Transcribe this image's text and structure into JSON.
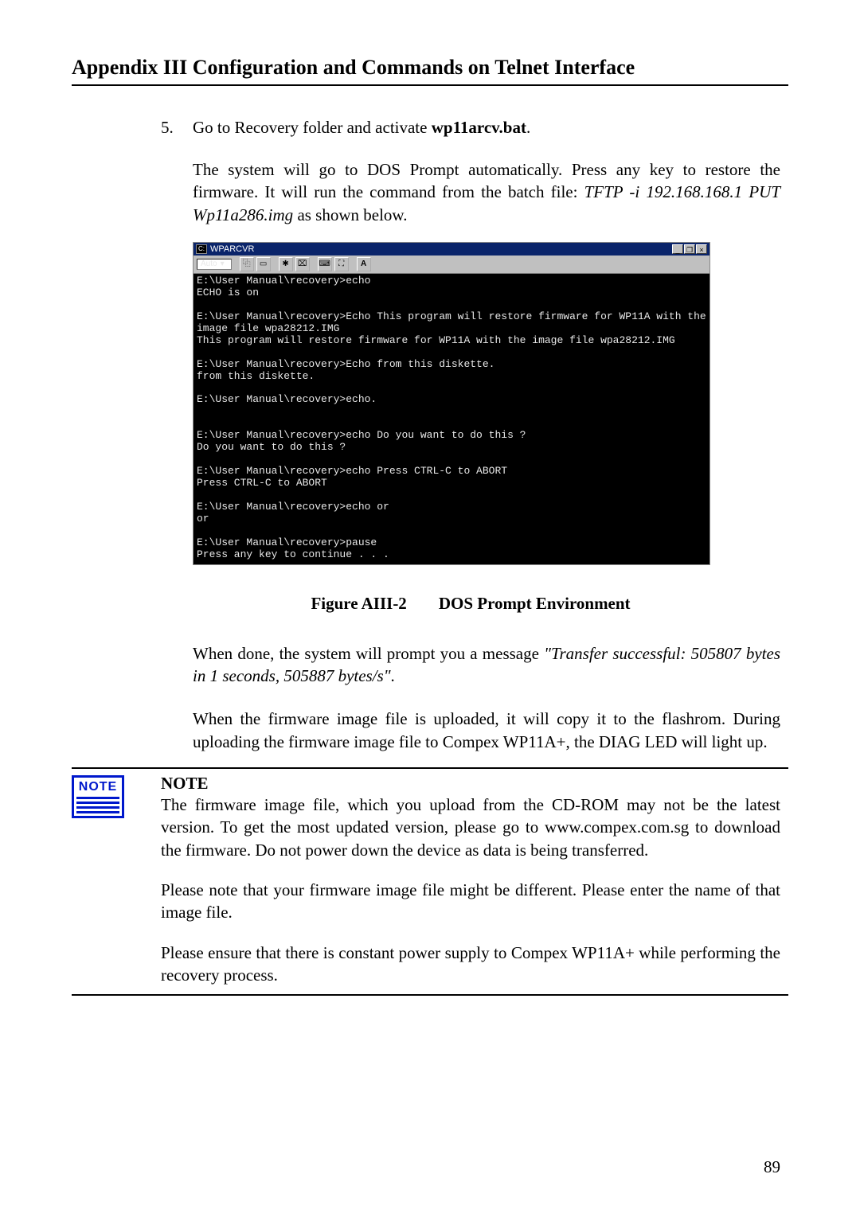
{
  "header_title": "Appendix III  Configuration and Commands on Telnet Interface",
  "list_number": "5.",
  "step5_prefix": "Go to Recovery folder and activate ",
  "step5_bold": "wp11arcv.bat",
  "step5_suffix": ".",
  "para1_prefix": "The system will go to DOS Prompt automatically. Press any key to restore the firmware. It will run the command from the batch file: ",
  "para1_italic": "TFTP -i 192.168.168.1 PUT Wp11a286.img",
  "para1_suffix": " as shown below.",
  "dos": {
    "title": "WPARCVR",
    "toolbar_select": "Auto",
    "lines": [
      "E:\\User Manual\\recovery>echo",
      "ECHO is on",
      "",
      "E:\\User Manual\\recovery>Echo This program will restore firmware for WP11A with the image file wpa28212.IMG",
      "This program will restore firmware for WP11A with the image file wpa28212.IMG",
      "",
      "E:\\User Manual\\recovery>Echo from this diskette.",
      "from this diskette.",
      "",
      "E:\\User Manual\\recovery>echo.",
      "",
      "",
      "E:\\User Manual\\recovery>echo Do you want to do this ?",
      "Do you want to do this ?",
      "",
      "E:\\User Manual\\recovery>echo Press CTRL-C to ABORT",
      "Press CTRL-C to ABORT",
      "",
      "E:\\User Manual\\recovery>echo or",
      "or",
      "",
      "E:\\User Manual\\recovery>pause",
      "Press any key to continue . . ."
    ]
  },
  "figure_code": "Figure AIII-2",
  "figure_caption": "DOS Prompt Environment",
  "para2_prefix": "When done, the system will prompt you a message ",
  "para2_italic": "\"Transfer successful: 505807 bytes in 1 seconds, 505887 bytes/s\"",
  "para2_suffix": ".",
  "para3": "When the firmware image file is uploaded, it will copy it to the flashrom. During uploading the firmware image file to Compex WP11A+, the DIAG LED will light up.",
  "note_icon": "NOTE",
  "note_title": "NOTE",
  "note_para1": "The firmware image file, which you upload from the CD-ROM may not be the latest version. To get the most updated version, please go to www.compex.com.sg to download the firmware. Do not power down the device as data is being transferred.",
  "note_para2": "Please note that your firmware image file might be different. Please enter the name of that image file.",
  "note_para3": "Please ensure that there is constant power supply to Compex WP11A+ while performing the recovery process.",
  "page_number": "89",
  "window_buttons": {
    "min": "_",
    "max": "❐",
    "close": "×"
  },
  "toolbar_icons": [
    "copy-icon",
    "paste-icon",
    "props-icon",
    "mark-icon",
    "font-a-icon"
  ]
}
